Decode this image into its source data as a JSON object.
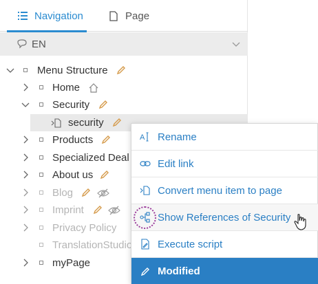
{
  "tabs": {
    "navigation": "Navigation",
    "page": "Page"
  },
  "language": {
    "code": "EN"
  },
  "tree": {
    "items": [
      {
        "label": "Menu Structure"
      },
      {
        "label": "Home"
      },
      {
        "label": "Security"
      },
      {
        "label": "security"
      },
      {
        "label": "Products"
      },
      {
        "label": "Specialized Deal"
      },
      {
        "label": "About us"
      },
      {
        "label": "Blog"
      },
      {
        "label": "Imprint"
      },
      {
        "label": "Privacy Policy"
      },
      {
        "label": "TranslationStudio"
      },
      {
        "label": "myPage"
      }
    ]
  },
  "context_menu": {
    "rename": "Rename",
    "edit_link": "Edit link",
    "convert": "Convert menu item to page",
    "show_references": "Show References of Security",
    "execute_script": "Execute script",
    "modified": "Modified"
  },
  "colors": {
    "accent": "#2a8bd0",
    "menu_active": "#2a7fc4",
    "muted_text": "#b5b5b5",
    "highlight_circle": "#9b3b9b"
  }
}
